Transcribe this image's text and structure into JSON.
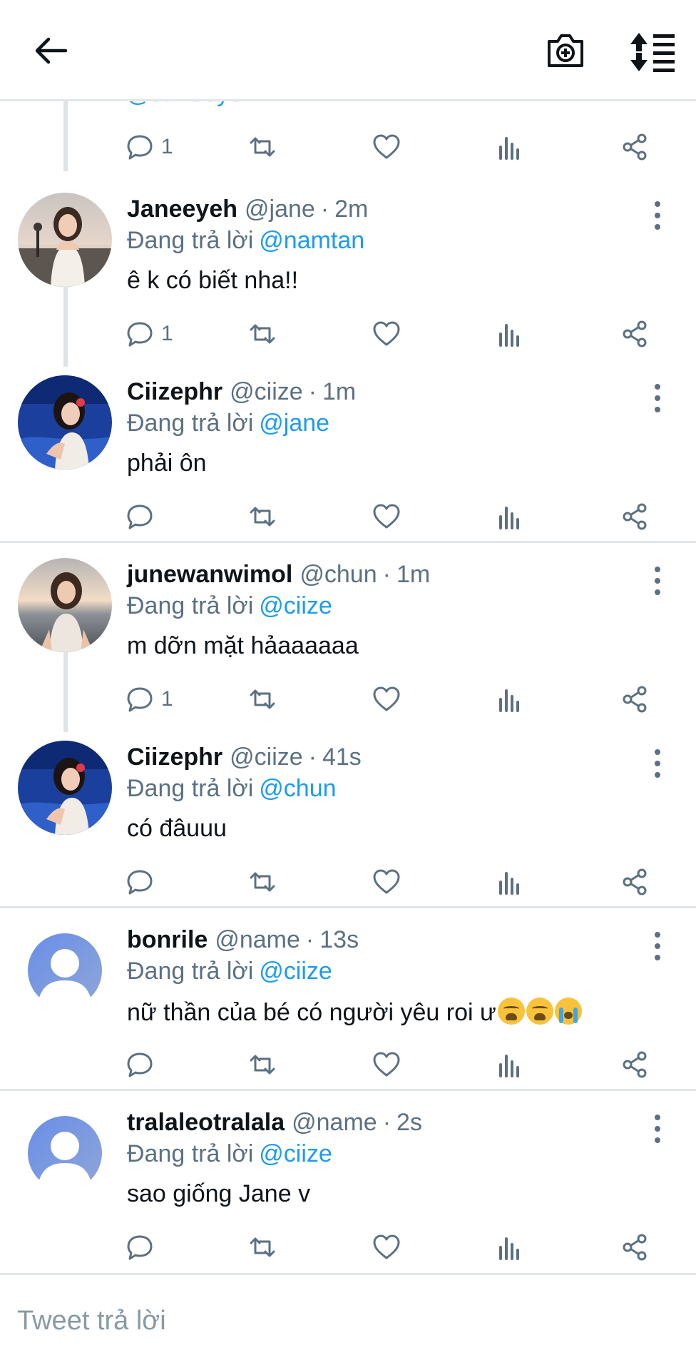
{
  "header": {
    "back_icon": "arrow-left-icon",
    "camera_icon": "camera-plus-icon",
    "sort_icon": "sort-list-icon"
  },
  "partial_top": {
    "handle_text": "@Janeeyeh",
    "reply_count": "1"
  },
  "replying_prefix": "Đang trả lời",
  "replies": [
    {
      "name": "Janeeyeh",
      "handle": "@jane",
      "time": "2m",
      "replying_to": "@namtan",
      "text": "ê k có biết nha!!",
      "reply_count": "1",
      "avatar": "photo-sunset-girl"
    },
    {
      "name": "Ciizephr",
      "handle": "@ciize",
      "time": "1m",
      "replying_to": "@jane",
      "text": "phải ôn",
      "reply_count": "",
      "avatar": "photo-blue-pool-girl"
    },
    {
      "name": "junewanwimol",
      "handle": "@chun",
      "time": "1m",
      "replying_to": "@ciize",
      "text": "m dỡn mặt hảaaaaaa",
      "reply_count": "1",
      "avatar": "photo-beach-girl"
    },
    {
      "name": "Ciizephr",
      "handle": "@ciize",
      "time": "41s",
      "replying_to": "@chun",
      "text": "có đâuuu",
      "reply_count": "",
      "avatar": "photo-blue-pool-girl"
    },
    {
      "name": "bonrile",
      "handle": "@name",
      "time": "13s",
      "replying_to": "@ciize",
      "text": "nữ thần của bé có người yêu roi ư",
      "reply_count": "",
      "avatar": "default-user",
      "emojis": [
        "weary-face",
        "weary-face",
        "loudly-crying-face"
      ]
    },
    {
      "name": "tralaleotralala",
      "handle": "@name",
      "time": "2s",
      "replying_to": "@ciize",
      "text": "sao giống Jane v",
      "reply_count": "",
      "avatar": "default-user"
    }
  ],
  "composer": {
    "placeholder": "Tweet trả lời"
  },
  "colors": {
    "link": "#1d9bf0",
    "muted": "#5b7083",
    "divider": "#e3e6e8",
    "default_avatar": "#6e8ee0"
  }
}
